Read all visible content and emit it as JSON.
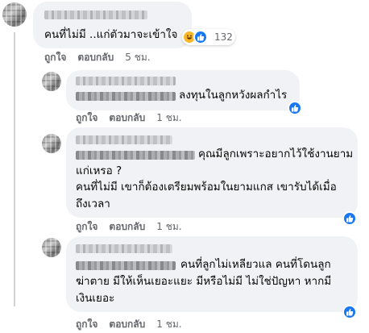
{
  "comments": [
    {
      "text_lines": [
        "คนที่ไม่มี ..แก่ตัวมาจะเข้าใจ"
      ],
      "reactions": [
        "haha-icon",
        "like-icon"
      ],
      "reaction_count": "132",
      "like_label": "ถูกใจ",
      "reply_label": "ตอบกลับ",
      "time": "5 ชม."
    },
    {
      "text_lines": [
        "ลงทุนในลูกหวังผลกำไร"
      ],
      "reactions": [
        "like-icon"
      ],
      "like_label": "ถูกใจ",
      "reply_label": "ตอบกลับ",
      "time": "1 ชม."
    },
    {
      "text_lines": [
        "คุณมีลูกเพราะอยากไว้ใช้งานยาม",
        "แก่เหรอ ?",
        "คนที่ไม่มี เขาก็ต้องเตรียมพร้อมในยามแกส เขารับได้เมื่อ",
        "ถึงเวลา"
      ],
      "reactions": [
        "like-icon"
      ],
      "like_label": "ถูกใจ",
      "reply_label": "ตอบกลับ",
      "time": "1 ชม."
    },
    {
      "text_lines": [
        "คนที่ลูกไม่เหลียวแล คนที่โดนลูก",
        "ฆ่าตาย มีให้เห็นเยอะแยะ มีหรือไม่มี ไม่ใช่ปัญหา หากมี",
        "เงินเยอะ"
      ],
      "reactions": [
        "like-icon"
      ],
      "like_label": "ถูกใจ",
      "reply_label": "ตอบกลับ",
      "time": "1 ชม."
    }
  ],
  "colors": {
    "bubble": "#f0f2f5",
    "like_blue": "#1877f2",
    "haha_yellow": "#f7b928",
    "meta_gray": "#65676b"
  }
}
